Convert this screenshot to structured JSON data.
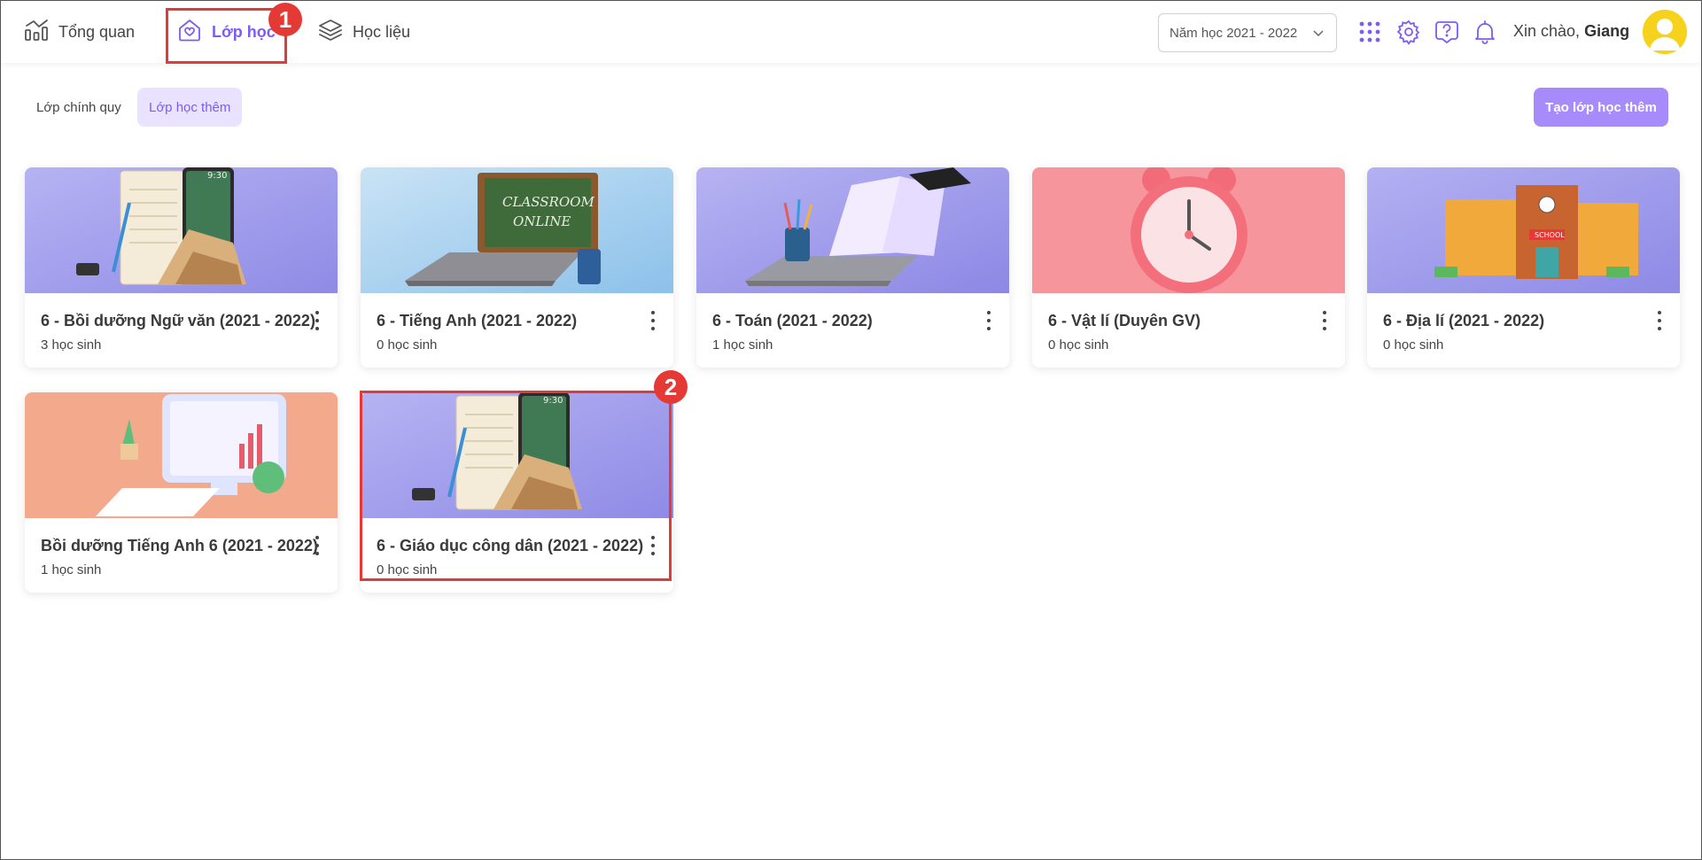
{
  "nav": {
    "overview": "Tổng quan",
    "classes": "Lớp học",
    "materials": "Học liệu"
  },
  "header": {
    "year_select": "Năm học 2021 - 2022",
    "greeting": "Xin chào,",
    "user_name": "Giang"
  },
  "tabs": {
    "regular": "Lớp chính quy",
    "extra": "Lớp học thêm"
  },
  "create_button": "Tạo lớp học thêm",
  "annotations": {
    "one": "1",
    "two": "2"
  },
  "cards": [
    {
      "title": "6 - Bồi dưỡng Ngữ văn (2021 - 2022)",
      "count": "3 học sinh",
      "thumb": "notebook-book",
      "bg": "#a9a6ee",
      "clock_text": "9:30"
    },
    {
      "title": "6 - Tiếng Anh (2021 - 2022)",
      "count": "0 học sinh",
      "thumb": "classroom-online",
      "bg": "#9fcdee",
      "board_text_1": "CLASSROOM",
      "board_text_2": "ONLINE"
    },
    {
      "title": "6 - Toán (2021 - 2022)",
      "count": "1 học sinh",
      "thumb": "laptop-book",
      "bg": "#a6a3f0"
    },
    {
      "title": "6 - Vật lí (Duyên GV)",
      "count": "0 học sinh",
      "thumb": "alarm-clock",
      "bg": "#f7949c"
    },
    {
      "title": "6 - Địa lí (2021 - 2022)",
      "count": "0 học sinh",
      "thumb": "school-building",
      "bg": "#a2a0ef",
      "sign_text": "SCHOOL"
    },
    {
      "title": "Bồi dưỡng Tiếng Anh 6 (2021 - 2022)",
      "count": "1 học sinh",
      "thumb": "computer-desk",
      "bg": "#f3a98c"
    },
    {
      "title": "6 - Giáo dục công dân (2021 - 2022)",
      "count": "0 học sinh",
      "thumb": "notebook-book",
      "bg": "#a9a6ee",
      "clock_text": "9:30"
    }
  ],
  "colors": {
    "accent": "#7c5cf5",
    "accent_light": "#e9e3ff",
    "button": "#a78bfa",
    "annotation": "#e53935"
  }
}
